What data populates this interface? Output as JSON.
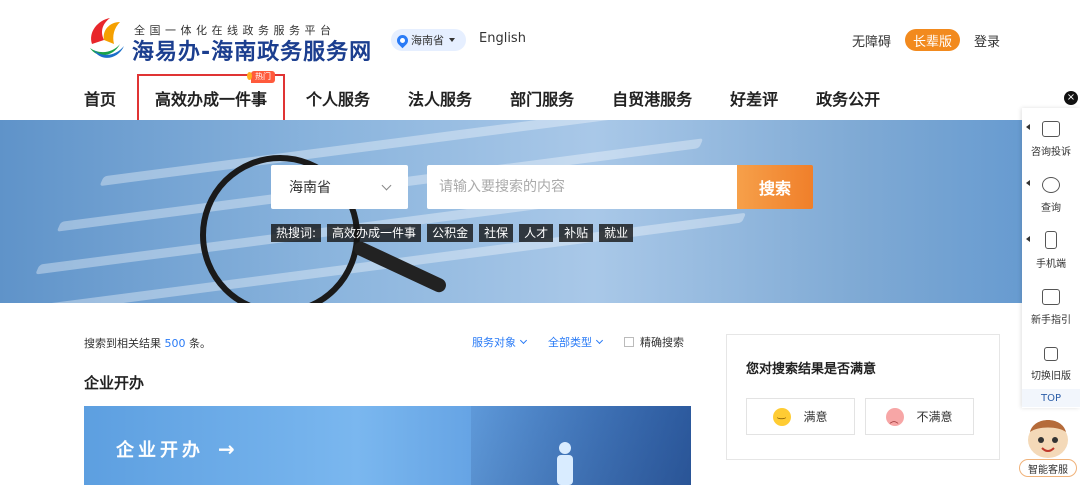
{
  "header": {
    "logo_subtitle": "全国一体化在线政务服务平台",
    "logo_title": "海易办-海南政务服务网",
    "region": "海南省",
    "language": "English",
    "accessibility": "无障碍",
    "elder_mode": "长辈版",
    "login": "登录"
  },
  "nav": {
    "items": [
      "首页",
      "高效办成一件事",
      "个人服务",
      "法人服务",
      "部门服务",
      "自贸港服务",
      "好差评",
      "政务公开"
    ],
    "active_index": 1,
    "hot_tag": "热门"
  },
  "search": {
    "region_select": "海南省",
    "placeholder": "请输入要搜索的内容",
    "button": "搜索",
    "hot_label": "热搜词:",
    "hot_words": [
      "高效办成一件事",
      "公积金",
      "社保",
      "人才",
      "补贴",
      "就业"
    ]
  },
  "results": {
    "prefix": "搜索到相关结果",
    "count": "500",
    "suffix": "条。",
    "filter_service_target": "服务对象",
    "filter_all_types": "全部类型",
    "exact_search": "精确搜索",
    "section_title": "企业开办",
    "card_label": "企业开办",
    "card_arrow": "→"
  },
  "feedback": {
    "title": "您对搜索结果是否满意",
    "satisfied": "满意",
    "unsatisfied": "不满意"
  },
  "float_bar": {
    "close": "×",
    "items": [
      "咨询投诉",
      "查询",
      "手机端",
      "新手指引",
      "切换旧版"
    ],
    "top": "TOP",
    "assistant": "智能客服"
  },
  "colors": {
    "brand_blue": "#1b3e8f",
    "accent_orange": "#f07f2a",
    "link_blue": "#2a7bf6",
    "active_border": "#e03434"
  }
}
